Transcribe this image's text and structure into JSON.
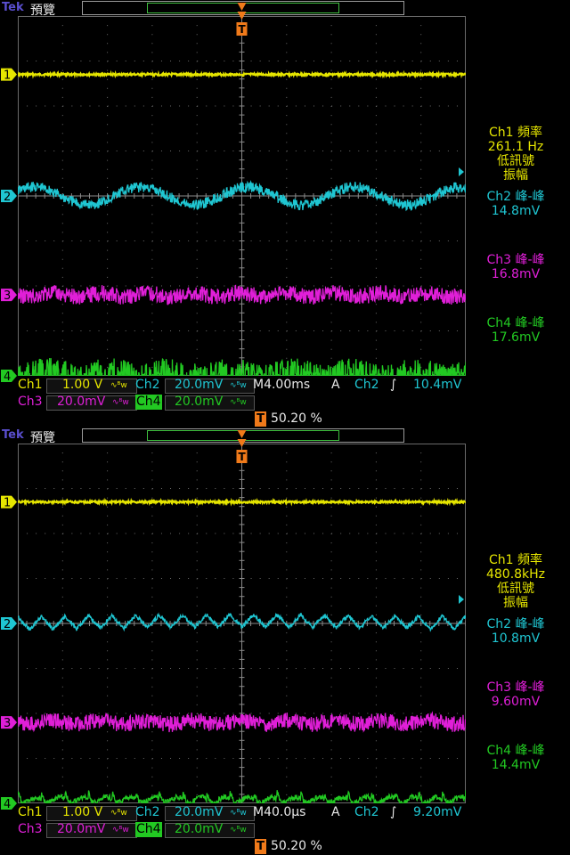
{
  "colors": {
    "ch1": "#e6e600",
    "ch2": "#1fc6d2",
    "ch3": "#e01fd8",
    "ch4": "#22c922",
    "trigger": "#f07a1a",
    "grid": "#6a6a6a"
  },
  "scopes": [
    {
      "brand": "Tek",
      "mode": "預覽",
      "trigger_marker": "T",
      "channel_markers": [
        "1",
        "2",
        "3",
        "4"
      ],
      "measurements": {
        "ch1_label": "Ch1 頻率",
        "ch1_value": "261.1 Hz",
        "ch1_note1": "低訊號",
        "ch1_note2": "振幅",
        "ch2_label": "Ch2 峰-峰",
        "ch2_value": "14.8mV",
        "ch3_label": "Ch3 峰-峰",
        "ch3_value": "16.8mV",
        "ch4_label": "Ch4 峰-峰",
        "ch4_value": "17.6mV"
      },
      "settings": {
        "ch1": "Ch1",
        "ch1_scale": "1.00 V",
        "ch2": "Ch2",
        "ch2_scale": "20.0mV",
        "ch3": "Ch3",
        "ch3_scale": "20.0mV",
        "ch4": "Ch4",
        "ch4_scale": "20.0mV",
        "bw": "∿ᴮw",
        "timebase": "M4.00ms",
        "acq": "A",
        "trig_ch": "Ch2",
        "trig_slope": "∫",
        "trig_level": "10.4mV",
        "trig_pos": "50.20 %"
      }
    },
    {
      "brand": "Tek",
      "mode": "預覽",
      "trigger_marker": "T",
      "channel_markers": [
        "1",
        "2",
        "3",
        "4"
      ],
      "measurements": {
        "ch1_label": "Ch1 頻率",
        "ch1_value": "480.8kHz",
        "ch1_note1": "低訊號",
        "ch1_note2": "振幅",
        "ch2_label": "Ch2 峰-峰",
        "ch2_value": "10.8mV",
        "ch3_label": "Ch3 峰-峰",
        "ch3_value": "9.60mV",
        "ch4_label": "Ch4 峰-峰",
        "ch4_value": "14.4mV"
      },
      "settings": {
        "ch1": "Ch1",
        "ch1_scale": "1.00 V",
        "ch2": "Ch2",
        "ch2_scale": "20.0mV",
        "ch3": "Ch3",
        "ch3_scale": "20.0mV",
        "ch4": "Ch4",
        "ch4_scale": "20.0mV",
        "bw": "∿ᴮw",
        "timebase": "M40.0µs",
        "acq": "A",
        "trig_ch": "Ch2",
        "trig_slope": "∫",
        "trig_level": "9.20mV",
        "trig_pos": "50.20 %"
      }
    }
  ],
  "chart_data": [
    {
      "type": "line",
      "timebase": "M4.00ms",
      "grid": true,
      "series": [
        {
          "name": "Ch1",
          "divisions_from_top": 1.3,
          "pattern": "flat",
          "cycles": 0,
          "noise": 0.05
        },
        {
          "name": "Ch2",
          "divisions_from_top": 4.0,
          "pattern": "sine",
          "cycles": 4.2,
          "noise": 0.35
        },
        {
          "name": "Ch3",
          "divisions_from_top": 6.2,
          "pattern": "noisy",
          "cycles": 5,
          "noise": 0.6
        },
        {
          "name": "Ch4",
          "divisions_from_top": 8.0,
          "pattern": "burst",
          "cycles": 0,
          "noise": 0.9
        }
      ]
    },
    {
      "type": "line",
      "timebase": "M40.0µs",
      "grid": true,
      "series": [
        {
          "name": "Ch1",
          "divisions_from_top": 1.3,
          "pattern": "flat",
          "cycles": 0,
          "noise": 0.05
        },
        {
          "name": "Ch2",
          "divisions_from_top": 4.0,
          "pattern": "triangle",
          "cycles": 19,
          "noise": 0.15
        },
        {
          "name": "Ch3",
          "divisions_from_top": 6.2,
          "pattern": "noisy",
          "cycles": 0,
          "noise": 0.2
        },
        {
          "name": "Ch4",
          "divisions_from_top": 8.0,
          "pattern": "spike",
          "cycles": 19,
          "noise": 0.2
        }
      ]
    }
  ]
}
